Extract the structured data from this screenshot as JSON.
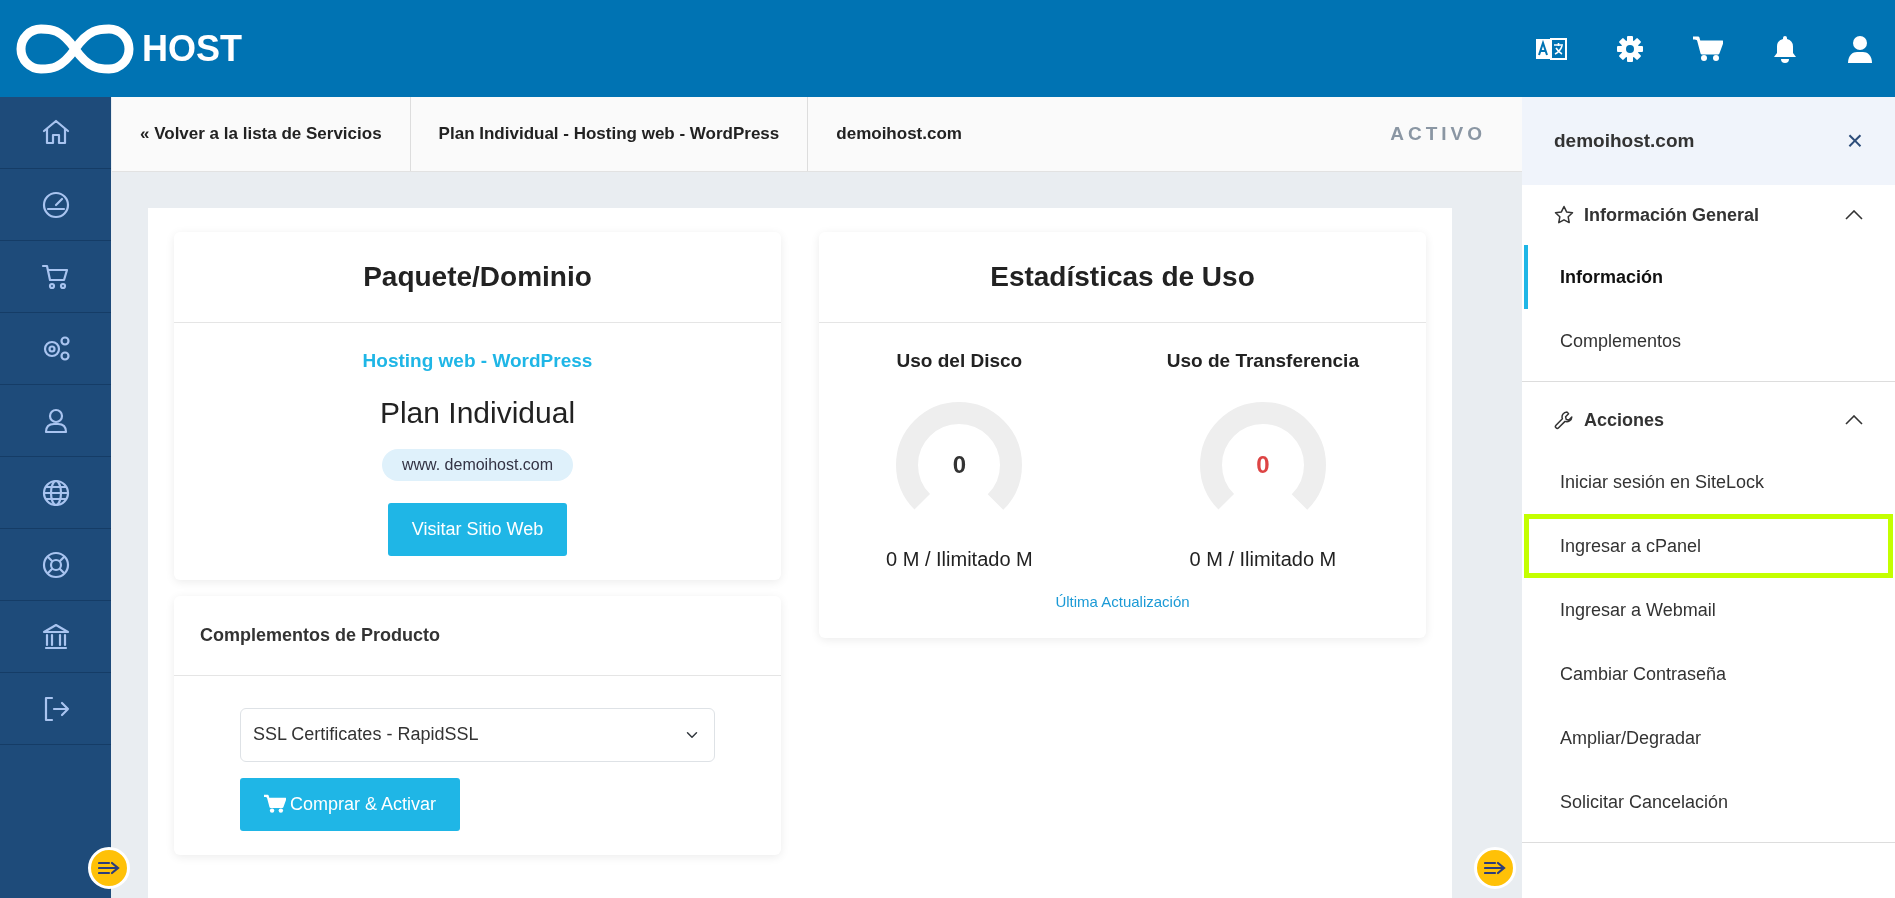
{
  "header": {
    "logo_text": "HOST"
  },
  "breadcrumb": [
    {
      "label": "« Volver a la lista de Servicios"
    },
    {
      "label": "Plan Individual - Hosting web - WordPress"
    },
    {
      "label": "demoihost.com"
    }
  ],
  "status": "ACTIVO",
  "package_card": {
    "title": "Paquete/Dominio",
    "product_group": "Hosting web - WordPress",
    "product": "Plan Individual",
    "domain": "www. demoihost.com",
    "button": "Visitar Sitio Web"
  },
  "addons_card": {
    "title": "Complementos de Producto",
    "select_value": "SSL Certificates - RapidSSL",
    "button": "Comprar & Activar"
  },
  "stats_card": {
    "title": "Estadísticas de Uso",
    "gauges": [
      {
        "label": "Uso del Disco",
        "value": "0",
        "level": 0,
        "color": "#333333",
        "reading": "0 M / Ilimitado M"
      },
      {
        "label": "Uso de Transferencia",
        "value": "0",
        "level": 0,
        "color": "#dd4444",
        "reading": "0 M / Ilimitado M"
      }
    ],
    "link": "Última Actualización"
  },
  "panel": {
    "title": "demoihost.com",
    "close": "×",
    "sections": [
      {
        "title": "Información General",
        "kind": "star",
        "expanded": true,
        "items": [
          {
            "label": "Información",
            "selected": true,
            "highlighted": false
          },
          {
            "label": "Complementos",
            "selected": false,
            "highlighted": false
          }
        ]
      },
      {
        "title": "Acciones",
        "kind": "wrench",
        "expanded": true,
        "items": [
          {
            "label": "Iniciar sesión en SiteLock",
            "selected": false,
            "highlighted": false
          },
          {
            "label": "Ingresar a cPanel",
            "selected": false,
            "highlighted": true
          },
          {
            "label": "Ingresar a Webmail",
            "selected": false,
            "highlighted": false
          },
          {
            "label": "Cambiar Contraseña",
            "selected": false,
            "highlighted": false
          },
          {
            "label": "Ampliar/Degradar",
            "selected": false,
            "highlighted": false
          },
          {
            "label": "Solicitar Cancelación",
            "selected": false,
            "highlighted": false
          }
        ]
      }
    ]
  }
}
